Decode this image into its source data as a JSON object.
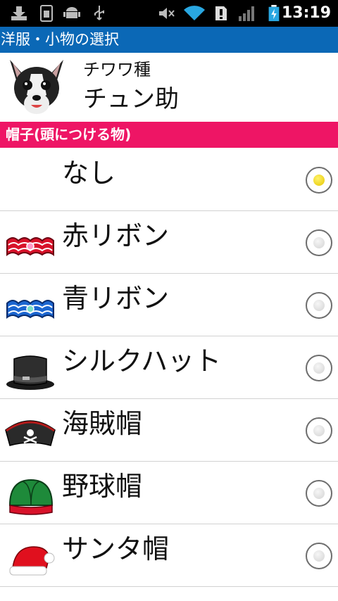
{
  "status_bar": {
    "time": "13:19",
    "icons": [
      "download-icon",
      "sim-icon",
      "android-icon",
      "usb-icon",
      "mute-icon",
      "wifi-icon",
      "alert-icon",
      "signal-icon",
      "battery-charging-icon"
    ]
  },
  "title_bar": {
    "title": "洋服・小物の選択"
  },
  "dog": {
    "breed": "チワワ種",
    "name": "チュン助"
  },
  "category": {
    "title": "帽子(頭につける物)"
  },
  "items": [
    {
      "label": "なし",
      "icon": "none",
      "selected": true
    },
    {
      "label": "赤リボン",
      "icon": "red-ribbon-icon",
      "selected": false
    },
    {
      "label": "青リボン",
      "icon": "blue-ribbon-icon",
      "selected": false
    },
    {
      "label": "シルクハット",
      "icon": "silk-hat-icon",
      "selected": false
    },
    {
      "label": "海賊帽",
      "icon": "pirate-hat-icon",
      "selected": false
    },
    {
      "label": "野球帽",
      "icon": "baseball-cap-icon",
      "selected": false
    },
    {
      "label": "サンタ帽",
      "icon": "santa-hat-icon",
      "selected": false
    }
  ],
  "colors": {
    "title_bar": "#0b68b6",
    "category_bar": "#ee1565",
    "radio_selected": "#f2d200"
  }
}
